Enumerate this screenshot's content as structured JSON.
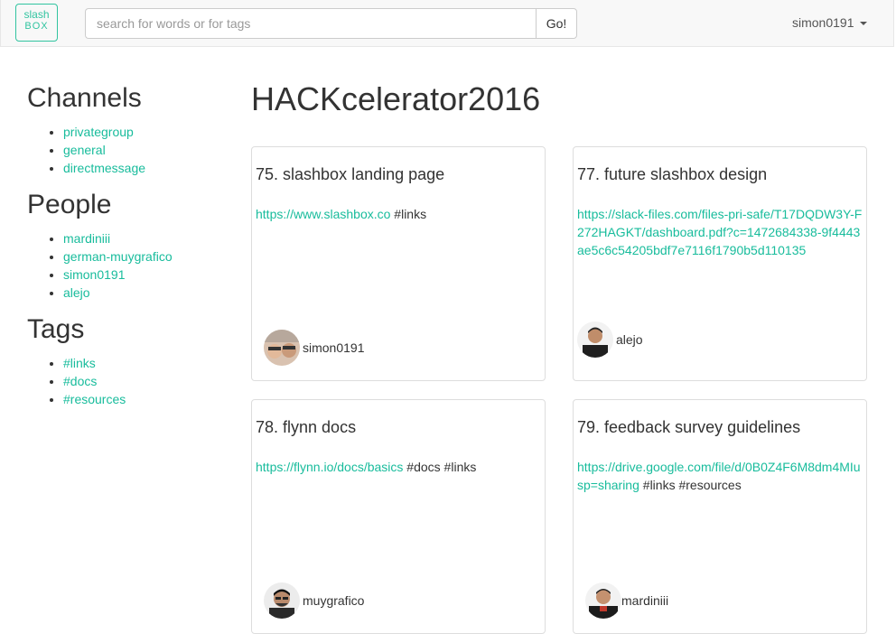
{
  "header": {
    "logo_top": "slash",
    "logo_bottom": "BOX",
    "search_placeholder": "search for words or for tags",
    "search_button": "Go!",
    "user": "simon0191"
  },
  "sidebar": {
    "channels_title": "Channels",
    "channels": [
      "privategroup",
      "general",
      "directmessage"
    ],
    "people_title": "People",
    "people": [
      "mardiniii",
      "german-muygrafico",
      "simon0191",
      "alejo"
    ],
    "tags_title": "Tags",
    "tags": [
      "#links",
      "#docs",
      "#resources"
    ]
  },
  "main": {
    "title": "HACKcelerator2016",
    "cards": [
      {
        "title": "75. slashbox landing page",
        "link": "https://www.slashbox.co",
        "tags": " #links",
        "author": "simon0191"
      },
      {
        "title": "77. future slashbox design",
        "link": "https://slack-files.com/files-pri-safe/T17DQDW3Y-F272HAGKT/dashboard.pdf?c=1472684338-9f4443ae5c6c54205bdf7e7116f1790b5d110135",
        "tags": "",
        "author": "alejo"
      },
      {
        "title": "78. flynn docs",
        "link": "https://flynn.io/docs/basics",
        "tags": " #docs #links",
        "author": "muygrafico"
      },
      {
        "title": "79. feedback survey guidelines",
        "link": "https://drive.google.com/file/d/0B0Z4F6M8dm4MIusp=sharing",
        "tags": " #links #resources",
        "author": "mardiniii"
      }
    ]
  },
  "colors": {
    "accent": "#18bc9c",
    "navbar": "#f8f8f8"
  }
}
